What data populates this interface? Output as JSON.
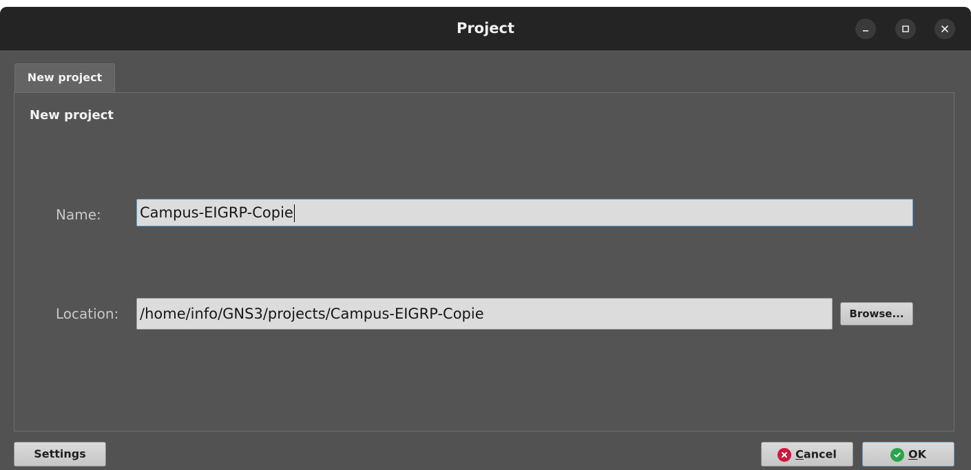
{
  "window": {
    "title": "Project",
    "controls": {
      "minimize": "minimize-icon",
      "maximize": "maximize-icon",
      "close": "close-icon"
    }
  },
  "tabs": [
    {
      "label": "New project",
      "active": true
    }
  ],
  "page": {
    "heading": "New project",
    "name_label": "Name:",
    "name_value": "Campus-EIGRP-Copie",
    "location_label": "Location:",
    "location_value": "/home/info/GNS3/projects/Campus-EIGRP-Copie",
    "browse_label": "Browse..."
  },
  "footer": {
    "settings_label": "Settings",
    "cancel": {
      "mnemonic": "C",
      "rest": "ancel",
      "icon": "cancel-icon",
      "color": "#d0163a"
    },
    "ok": {
      "mnemonic": "O",
      "rest": "K",
      "icon": "check-icon",
      "color": "#2aa44a"
    }
  }
}
